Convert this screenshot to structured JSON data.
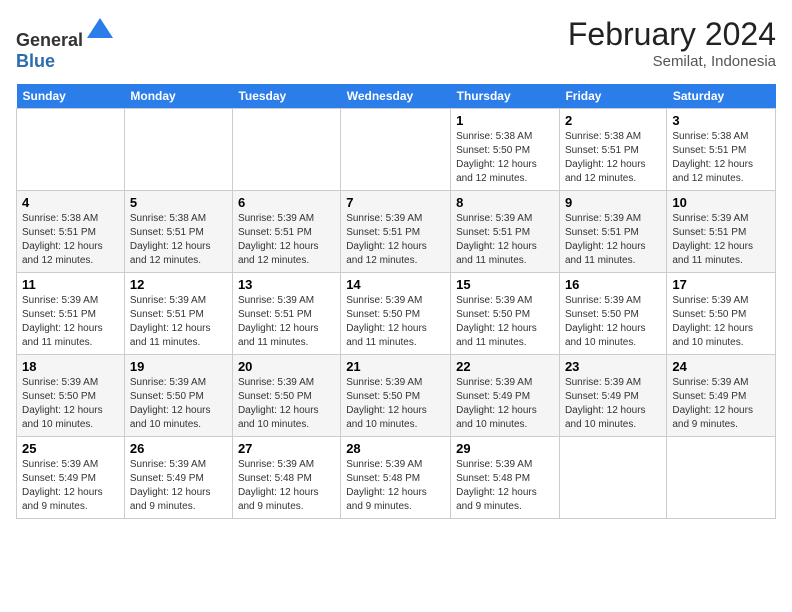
{
  "header": {
    "logo_general": "General",
    "logo_blue": "Blue",
    "title": "February 2024",
    "subtitle": "Semilat, Indonesia"
  },
  "days_of_week": [
    "Sunday",
    "Monday",
    "Tuesday",
    "Wednesday",
    "Thursday",
    "Friday",
    "Saturday"
  ],
  "weeks": [
    [
      {
        "day": "",
        "info": ""
      },
      {
        "day": "",
        "info": ""
      },
      {
        "day": "",
        "info": ""
      },
      {
        "day": "",
        "info": ""
      },
      {
        "day": "1",
        "info": "Sunrise: 5:38 AM\nSunset: 5:50 PM\nDaylight: 12 hours\nand 12 minutes."
      },
      {
        "day": "2",
        "info": "Sunrise: 5:38 AM\nSunset: 5:51 PM\nDaylight: 12 hours\nand 12 minutes."
      },
      {
        "day": "3",
        "info": "Sunrise: 5:38 AM\nSunset: 5:51 PM\nDaylight: 12 hours\nand 12 minutes."
      }
    ],
    [
      {
        "day": "4",
        "info": "Sunrise: 5:38 AM\nSunset: 5:51 PM\nDaylight: 12 hours\nand 12 minutes."
      },
      {
        "day": "5",
        "info": "Sunrise: 5:38 AM\nSunset: 5:51 PM\nDaylight: 12 hours\nand 12 minutes."
      },
      {
        "day": "6",
        "info": "Sunrise: 5:39 AM\nSunset: 5:51 PM\nDaylight: 12 hours\nand 12 minutes."
      },
      {
        "day": "7",
        "info": "Sunrise: 5:39 AM\nSunset: 5:51 PM\nDaylight: 12 hours\nand 12 minutes."
      },
      {
        "day": "8",
        "info": "Sunrise: 5:39 AM\nSunset: 5:51 PM\nDaylight: 12 hours\nand 11 minutes."
      },
      {
        "day": "9",
        "info": "Sunrise: 5:39 AM\nSunset: 5:51 PM\nDaylight: 12 hours\nand 11 minutes."
      },
      {
        "day": "10",
        "info": "Sunrise: 5:39 AM\nSunset: 5:51 PM\nDaylight: 12 hours\nand 11 minutes."
      }
    ],
    [
      {
        "day": "11",
        "info": "Sunrise: 5:39 AM\nSunset: 5:51 PM\nDaylight: 12 hours\nand 11 minutes."
      },
      {
        "day": "12",
        "info": "Sunrise: 5:39 AM\nSunset: 5:51 PM\nDaylight: 12 hours\nand 11 minutes."
      },
      {
        "day": "13",
        "info": "Sunrise: 5:39 AM\nSunset: 5:51 PM\nDaylight: 12 hours\nand 11 minutes."
      },
      {
        "day": "14",
        "info": "Sunrise: 5:39 AM\nSunset: 5:50 PM\nDaylight: 12 hours\nand 11 minutes."
      },
      {
        "day": "15",
        "info": "Sunrise: 5:39 AM\nSunset: 5:50 PM\nDaylight: 12 hours\nand 11 minutes."
      },
      {
        "day": "16",
        "info": "Sunrise: 5:39 AM\nSunset: 5:50 PM\nDaylight: 12 hours\nand 10 minutes."
      },
      {
        "day": "17",
        "info": "Sunrise: 5:39 AM\nSunset: 5:50 PM\nDaylight: 12 hours\nand 10 minutes."
      }
    ],
    [
      {
        "day": "18",
        "info": "Sunrise: 5:39 AM\nSunset: 5:50 PM\nDaylight: 12 hours\nand 10 minutes."
      },
      {
        "day": "19",
        "info": "Sunrise: 5:39 AM\nSunset: 5:50 PM\nDaylight: 12 hours\nand 10 minutes."
      },
      {
        "day": "20",
        "info": "Sunrise: 5:39 AM\nSunset: 5:50 PM\nDaylight: 12 hours\nand 10 minutes."
      },
      {
        "day": "21",
        "info": "Sunrise: 5:39 AM\nSunset: 5:50 PM\nDaylight: 12 hours\nand 10 minutes."
      },
      {
        "day": "22",
        "info": "Sunrise: 5:39 AM\nSunset: 5:49 PM\nDaylight: 12 hours\nand 10 minutes."
      },
      {
        "day": "23",
        "info": "Sunrise: 5:39 AM\nSunset: 5:49 PM\nDaylight: 12 hours\nand 10 minutes."
      },
      {
        "day": "24",
        "info": "Sunrise: 5:39 AM\nSunset: 5:49 PM\nDaylight: 12 hours\nand 9 minutes."
      }
    ],
    [
      {
        "day": "25",
        "info": "Sunrise: 5:39 AM\nSunset: 5:49 PM\nDaylight: 12 hours\nand 9 minutes."
      },
      {
        "day": "26",
        "info": "Sunrise: 5:39 AM\nSunset: 5:49 PM\nDaylight: 12 hours\nand 9 minutes."
      },
      {
        "day": "27",
        "info": "Sunrise: 5:39 AM\nSunset: 5:48 PM\nDaylight: 12 hours\nand 9 minutes."
      },
      {
        "day": "28",
        "info": "Sunrise: 5:39 AM\nSunset: 5:48 PM\nDaylight: 12 hours\nand 9 minutes."
      },
      {
        "day": "29",
        "info": "Sunrise: 5:39 AM\nSunset: 5:48 PM\nDaylight: 12 hours\nand 9 minutes."
      },
      {
        "day": "",
        "info": ""
      },
      {
        "day": "",
        "info": ""
      }
    ]
  ]
}
